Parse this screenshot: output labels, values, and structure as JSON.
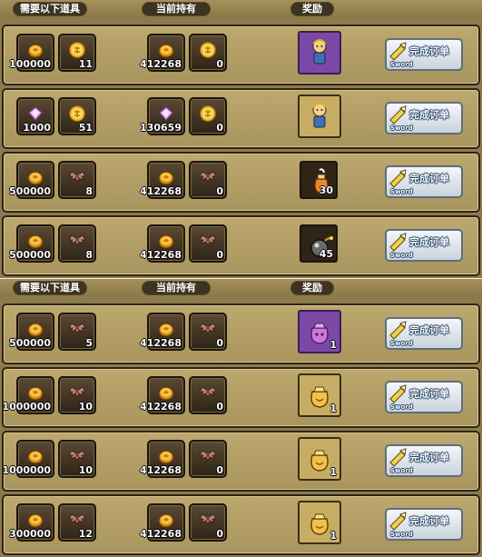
{
  "headers": {
    "need": "需要以下道具",
    "have": "当前持有",
    "reward": "奖励"
  },
  "button": {
    "label": "完成订单",
    "sub": "Sword"
  },
  "panels": [
    {
      "rows": [
        {
          "need": [
            {
              "icon": "coin-icon",
              "count": "100000"
            },
            {
              "icon": "gold-medal-icon",
              "count": "11"
            }
          ],
          "have": [
            {
              "icon": "coin-icon",
              "count": "412268"
            },
            {
              "icon": "gold-medal-icon",
              "count": "0"
            }
          ],
          "reward": {
            "icon": "character-portrait-icon",
            "count": "",
            "style": "pur"
          }
        },
        {
          "need": [
            {
              "icon": "gem-icon",
              "count": "1000"
            },
            {
              "icon": "gold-medal-icon",
              "count": "51"
            }
          ],
          "have": [
            {
              "icon": "gem-icon",
              "count": "130659"
            },
            {
              "icon": "gold-medal-icon",
              "count": "0"
            }
          ],
          "reward": {
            "icon": "character-portrait-icon",
            "count": "",
            "style": "gold"
          }
        },
        {
          "need": [
            {
              "icon": "coin-icon",
              "count": "500000"
            },
            {
              "icon": "bat-wing-icon",
              "count": "8"
            }
          ],
          "have": [
            {
              "icon": "coin-icon",
              "count": "412268"
            },
            {
              "icon": "bat-wing-icon",
              "count": "0"
            }
          ],
          "reward": {
            "icon": "potion-bag-icon",
            "count": "30",
            "style": "dark"
          }
        },
        {
          "need": [
            {
              "icon": "coin-icon",
              "count": "500000"
            },
            {
              "icon": "bat-wing-icon",
              "count": "8"
            }
          ],
          "have": [
            {
              "icon": "coin-icon",
              "count": "412268"
            },
            {
              "icon": "bat-wing-icon",
              "count": "0"
            }
          ],
          "reward": {
            "icon": "bomb-icon",
            "count": "45",
            "style": "dark"
          }
        }
      ]
    },
    {
      "rows": [
        {
          "need": [
            {
              "icon": "coin-icon",
              "count": "500000"
            },
            {
              "icon": "bat-wing-icon",
              "count": "5"
            }
          ],
          "have": [
            {
              "icon": "coin-icon",
              "count": "412268"
            },
            {
              "icon": "bat-wing-icon",
              "count": "0"
            }
          ],
          "reward": {
            "icon": "purple-pouch-icon",
            "count": "1",
            "style": "pur"
          }
        },
        {
          "need": [
            {
              "icon": "coin-icon",
              "count": "1000000"
            },
            {
              "icon": "bat-wing-icon",
              "count": "10"
            }
          ],
          "have": [
            {
              "icon": "coin-icon",
              "count": "412268"
            },
            {
              "icon": "bat-wing-icon",
              "count": "0"
            }
          ],
          "reward": {
            "icon": "gold-pouch-icon",
            "count": "1",
            "style": "gold"
          }
        },
        {
          "need": [
            {
              "icon": "coin-icon",
              "count": "1000000"
            },
            {
              "icon": "bat-wing-icon",
              "count": "10"
            }
          ],
          "have": [
            {
              "icon": "coin-icon",
              "count": "412268"
            },
            {
              "icon": "bat-wing-icon",
              "count": "0"
            }
          ],
          "reward": {
            "icon": "gold-pouch-icon",
            "count": "1",
            "style": "gold"
          }
        },
        {
          "need": [
            {
              "icon": "coin-icon",
              "count": "300000"
            },
            {
              "icon": "bat-wing-icon",
              "count": "12"
            }
          ],
          "have": [
            {
              "icon": "coin-icon",
              "count": "412268"
            },
            {
              "icon": "bat-wing-icon",
              "count": "0"
            }
          ],
          "reward": {
            "icon": "gold-pouch-icon",
            "count": "1",
            "style": "gold"
          }
        }
      ]
    }
  ]
}
